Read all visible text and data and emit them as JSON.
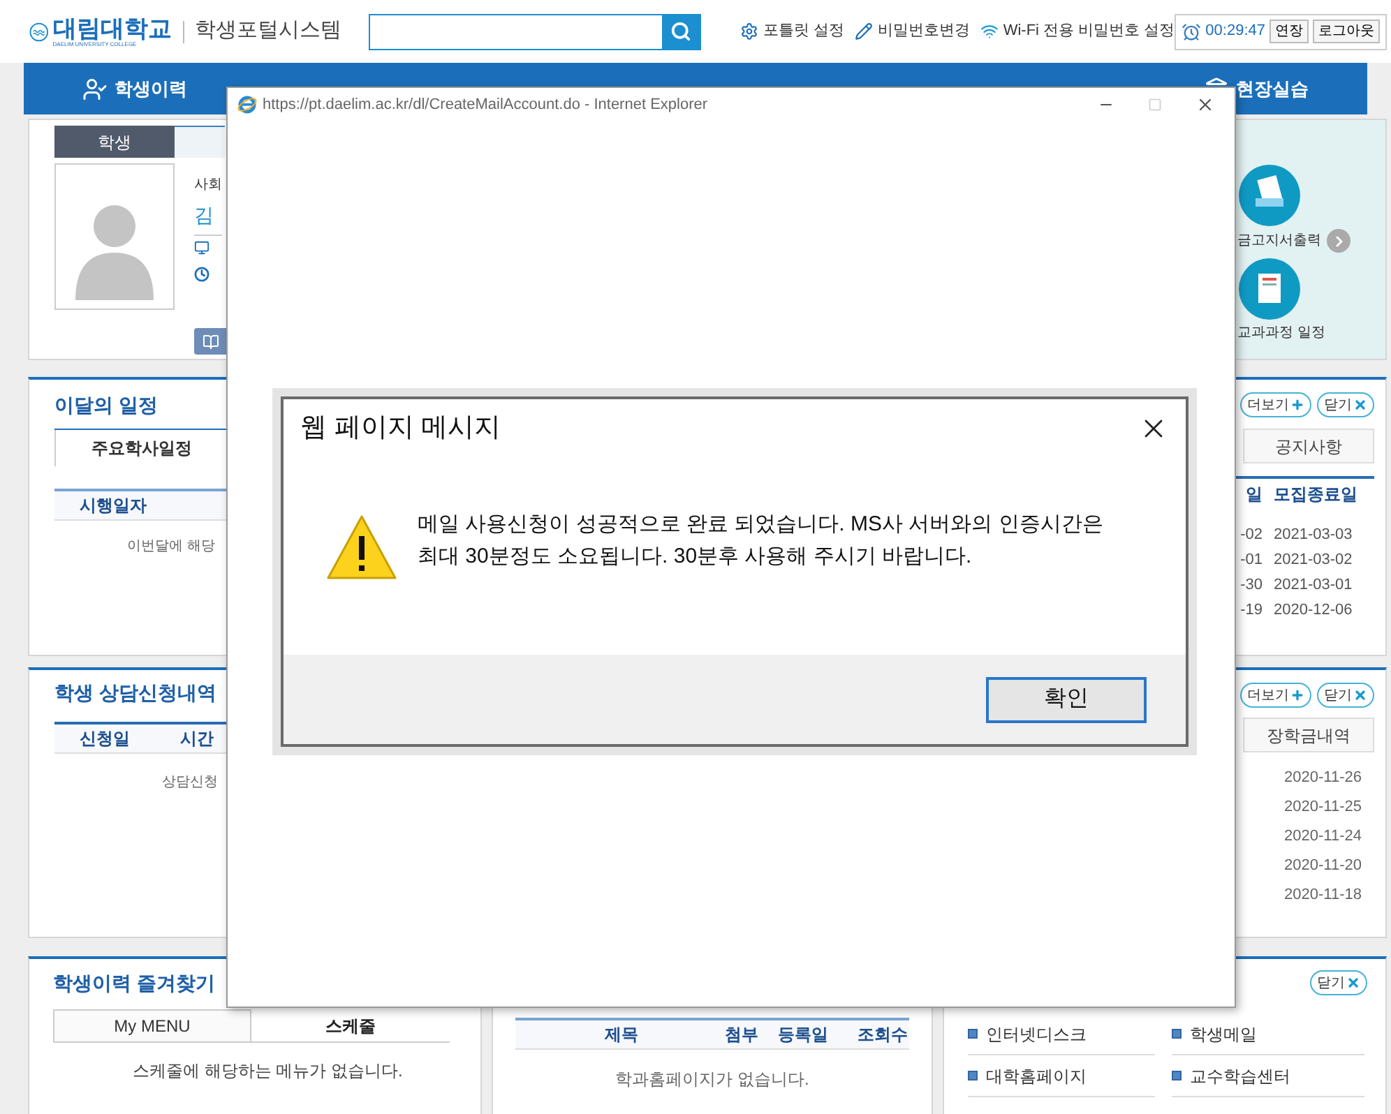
{
  "header": {
    "logo_name": "대림대학교",
    "logo_subtitle": "DAELIM UNIVERSITY COLLEGE",
    "system_name": "학생포털시스템",
    "links": [
      {
        "kind": "gear",
        "label": "포틀릿 설정"
      },
      {
        "kind": "pencil",
        "label": "비밀번호변경"
      },
      {
        "kind": "wifi",
        "label": "Wi-Fi 전용 비밀번호 설정"
      }
    ],
    "session": {
      "timer": "00:29:47",
      "extend": "연장",
      "logout": "로그아웃"
    }
  },
  "nav": [
    {
      "kind": "person",
      "label": "학생이력"
    },
    {
      "kind": "building",
      "label": "현장실습"
    }
  ],
  "profile": {
    "tabs": [
      {
        "label": "학생",
        "selected": true
      }
    ],
    "department": "사회",
    "name": "김",
    "quick_links": [
      {
        "kind": "receipt",
        "label": "금고지서출력",
        "arrow": true
      },
      {
        "kind": "notebook",
        "label": "교과과정 일정",
        "arrow": false
      }
    ]
  },
  "schedule": {
    "title": "이달의 일정",
    "tabs": [
      {
        "label": "주요학사일정",
        "selected": true
      }
    ],
    "columns": [
      "시행일자"
    ],
    "empty_message": "이번달에 해당"
  },
  "notice": {
    "more": "더보기",
    "close": "닫기",
    "tabs": [
      {
        "label": "공지사항",
        "selected": false
      }
    ],
    "columns": [
      "일",
      "모집종료일"
    ],
    "rows": [
      [
        "-02",
        "2021-03-03"
      ],
      [
        "-01",
        "2021-03-02"
      ],
      [
        "-30",
        "2021-03-01"
      ],
      [
        "-19",
        "2020-12-06"
      ]
    ]
  },
  "counsel": {
    "title": "학생 상담신청내역",
    "columns": [
      "신청일",
      "시간"
    ],
    "empty_message": "상담신청"
  },
  "scholarship": {
    "more": "더보기",
    "close": "닫기",
    "tabs": [
      {
        "label": "장학금내역",
        "selected": false
      }
    ],
    "rows": [
      "2020-11-26",
      "2020-11-25",
      "2020-11-24",
      "2020-11-20",
      "2020-11-18"
    ]
  },
  "favorites": {
    "title": "학생이력 즐겨찾기",
    "tabs": [
      {
        "label": "My MENU",
        "selected": false
      },
      {
        "label": "스케줄",
        "selected": true
      }
    ],
    "empty_message": "스케줄에 해당하는 메뉴가 없습니다."
  },
  "dept_home": {
    "columns": [
      "제목",
      "첨부",
      "등록일",
      "조회수"
    ],
    "empty_message": "학과홈페이지가 없습니다."
  },
  "links_panel": {
    "close": "닫기",
    "links": [
      "인터넷디스크",
      "학생메일",
      "대학홈페이지",
      "교수학습센터"
    ]
  },
  "popup": {
    "title": "https://pt.daelim.ac.kr/dl/CreateMailAccount.do - Internet Explorer",
    "dialog": {
      "title": "웹 페이지 메시지",
      "message": "메일 사용신청이 성공적으로 완료 되었습니다. MS사 서버와의 인증시간은 최대 30분정도 소요됩니다. 30분후 사용해 주시기 바랍니다.",
      "ok": "확인"
    }
  }
}
